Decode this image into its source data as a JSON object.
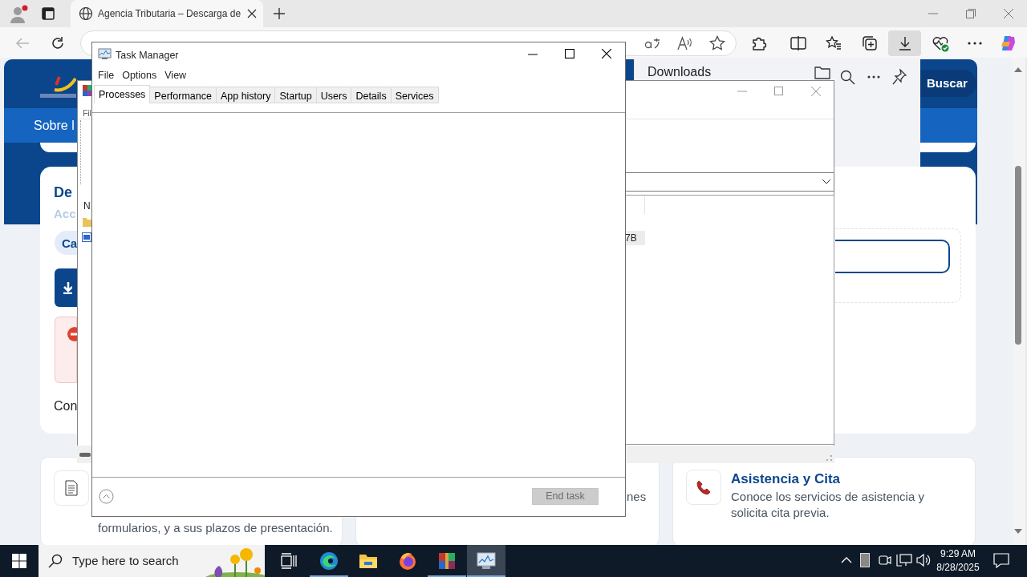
{
  "browser": {
    "tab": {
      "title": "Agencia Tributaria – Descarga de",
      "selected": true
    },
    "downloads_panel": {
      "title": "Downloads"
    },
    "page": {
      "search_button": "Buscar",
      "nav_text": "Sobre l",
      "heading": "De",
      "subheading": "Acc",
      "chip": "Ca",
      "footer_text": "Con",
      "cards": [
        {
          "kind": "document",
          "text": "formularios, y a sus plazos de presentación."
        },
        {
          "kind": "plain",
          "text": "nes"
        },
        {
          "kind": "phone",
          "title": "Asistencia y Cita",
          "text": "Conoce los servicios de asistencia y solicita cita previa."
        }
      ]
    }
  },
  "file_window": {
    "menu_fragment": "Fil",
    "column_fragment": "N",
    "cell_fragment": "7B"
  },
  "task_manager": {
    "title": "Task Manager",
    "menu": [
      "File",
      "Options",
      "View"
    ],
    "tabs": [
      {
        "label": "Processes",
        "selected": true
      },
      {
        "label": "Performance",
        "selected": false
      },
      {
        "label": "App history",
        "selected": false
      },
      {
        "label": "Startup",
        "selected": false
      },
      {
        "label": "Users",
        "selected": false
      },
      {
        "label": "Details",
        "selected": false
      },
      {
        "label": "Services",
        "selected": false
      }
    ],
    "end_task": {
      "label": "End task",
      "disabled": true
    }
  },
  "taskbar": {
    "search": {
      "placeholder": "Type here to search"
    },
    "apps": [
      {
        "kind": "taskview",
        "running": false,
        "active": false
      },
      {
        "kind": "edge",
        "running": true,
        "active": false
      },
      {
        "kind": "explorer",
        "running": false,
        "active": false
      },
      {
        "kind": "firefox",
        "running": false,
        "active": false
      },
      {
        "kind": "winrar",
        "running": true,
        "active": false
      },
      {
        "kind": "taskmanager",
        "running": true,
        "active": true
      }
    ],
    "time": "9:29 AM",
    "date": "8/28/2025"
  }
}
